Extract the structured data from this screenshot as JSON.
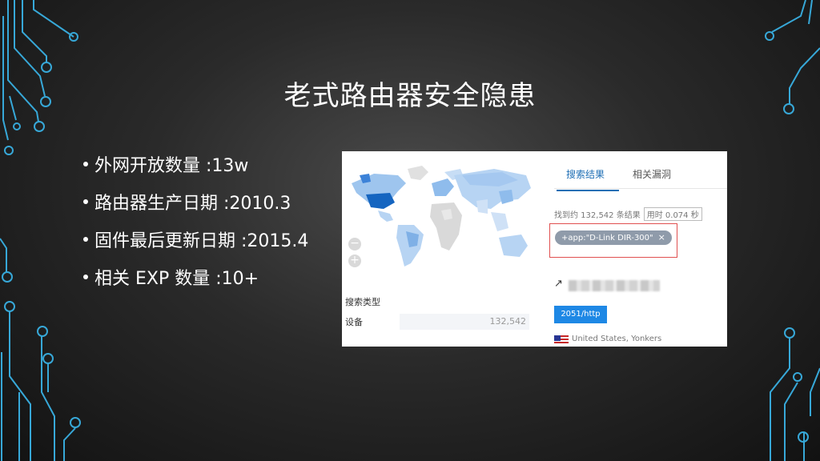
{
  "slide": {
    "title": "老式路由器安全隐患",
    "bullets": [
      "外网开放数量 :13w",
      "路由器生产日期 :2010.3",
      "固件最后更新日期 :2015.4",
      "相关 EXP 数量 :10+"
    ]
  },
  "screenshot": {
    "tabs": [
      "搜索结果",
      "相关漏洞"
    ],
    "found_text": "找到约 132,542 条结果",
    "time_badge": "用时 0.074 秒",
    "filter_chip": "+app:\"D-Link DIR-300\"",
    "chip_close": "×",
    "link_icon": "↗",
    "zoom_minus": "−",
    "zoom_plus": "+",
    "search_type_label": "搜索类型",
    "device_label": "设备",
    "device_count": "132,542",
    "port_button": "2051/http",
    "location": "United States, Yonkers"
  },
  "icons": [
    "circuit-decoration",
    "external-link-icon",
    "us-flag-icon",
    "close-icon"
  ],
  "colors": {
    "accent_circuit": "#37a8d8",
    "map_highlight": "#1565c0",
    "active_tab": "#1f6fb5",
    "filter_border": "#e05050",
    "port_button": "#1e88e5"
  }
}
